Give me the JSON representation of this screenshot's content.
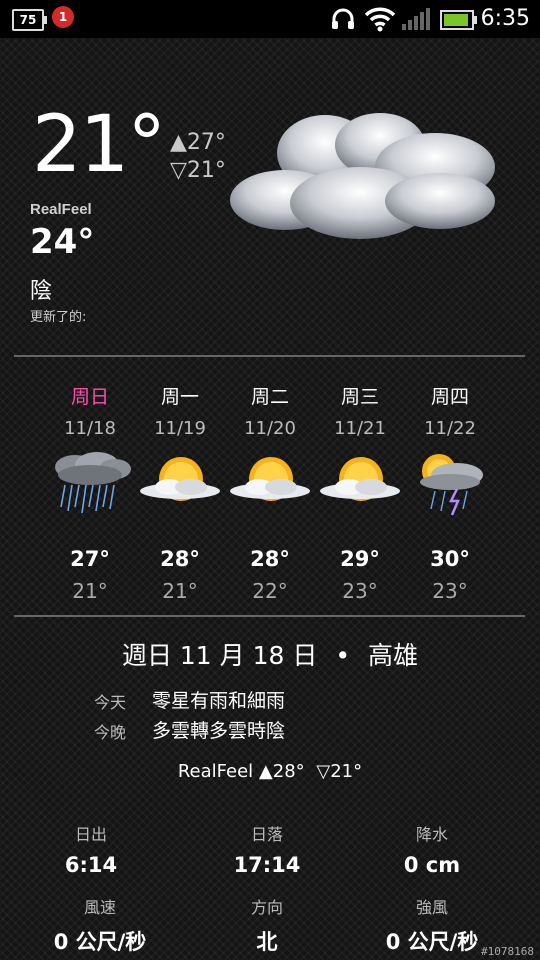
{
  "status_bar": {
    "battery_text": "75",
    "alarm_badge": "1",
    "time": "6:35",
    "icons": [
      "headset-icon",
      "wifi-icon",
      "signal-icon",
      "battery-icon"
    ]
  },
  "current": {
    "temperature": "21°",
    "high": "▲27°",
    "low": "▽21°",
    "realfeel_label": "RealFeel",
    "realfeel_value": "24°",
    "condition": "陰",
    "updated_label": "更新了的:",
    "icon": "cloudy-icon"
  },
  "forecast": [
    {
      "day": "周日",
      "date": "11/18",
      "high": "27°",
      "low": "21°",
      "icon": "rain-icon",
      "today": true
    },
    {
      "day": "周一",
      "date": "11/19",
      "high": "28°",
      "low": "21°",
      "icon": "sun-cloud-icon"
    },
    {
      "day": "周二",
      "date": "11/20",
      "high": "28°",
      "low": "22°",
      "icon": "sun-cloud-icon"
    },
    {
      "day": "周三",
      "date": "11/21",
      "high": "29°",
      "low": "23°",
      "icon": "sun-cloud-icon"
    },
    {
      "day": "周四",
      "date": "11/22",
      "high": "30°",
      "low": "23°",
      "icon": "thunderstorm-icon"
    }
  ],
  "detail": {
    "date_title": "週日 11 月 18 日",
    "bullet": "•",
    "city": "高雄",
    "today_label": "今天",
    "today_text": "零星有雨和細雨",
    "tonight_label": "今晚",
    "tonight_text": "多雲轉多雲時陰",
    "realfeel_label": "RealFeel",
    "realfeel_high": "▲28°",
    "realfeel_low": "▽21°",
    "stats": [
      {
        "label": "日出",
        "value": "6:14"
      },
      {
        "label": "日落",
        "value": "17:14"
      },
      {
        "label": "降水",
        "value": "0 cm"
      },
      {
        "label": "風速",
        "value": "0 公尺/秒"
      },
      {
        "label": "方向",
        "value": "北"
      },
      {
        "label": "強風",
        "value": "0 公尺/秒"
      }
    ]
  },
  "watermark": "#1078168",
  "colors": {
    "today": "#ff4fa8",
    "battery": "#7ac52a",
    "alarm": "#d32a2a"
  }
}
